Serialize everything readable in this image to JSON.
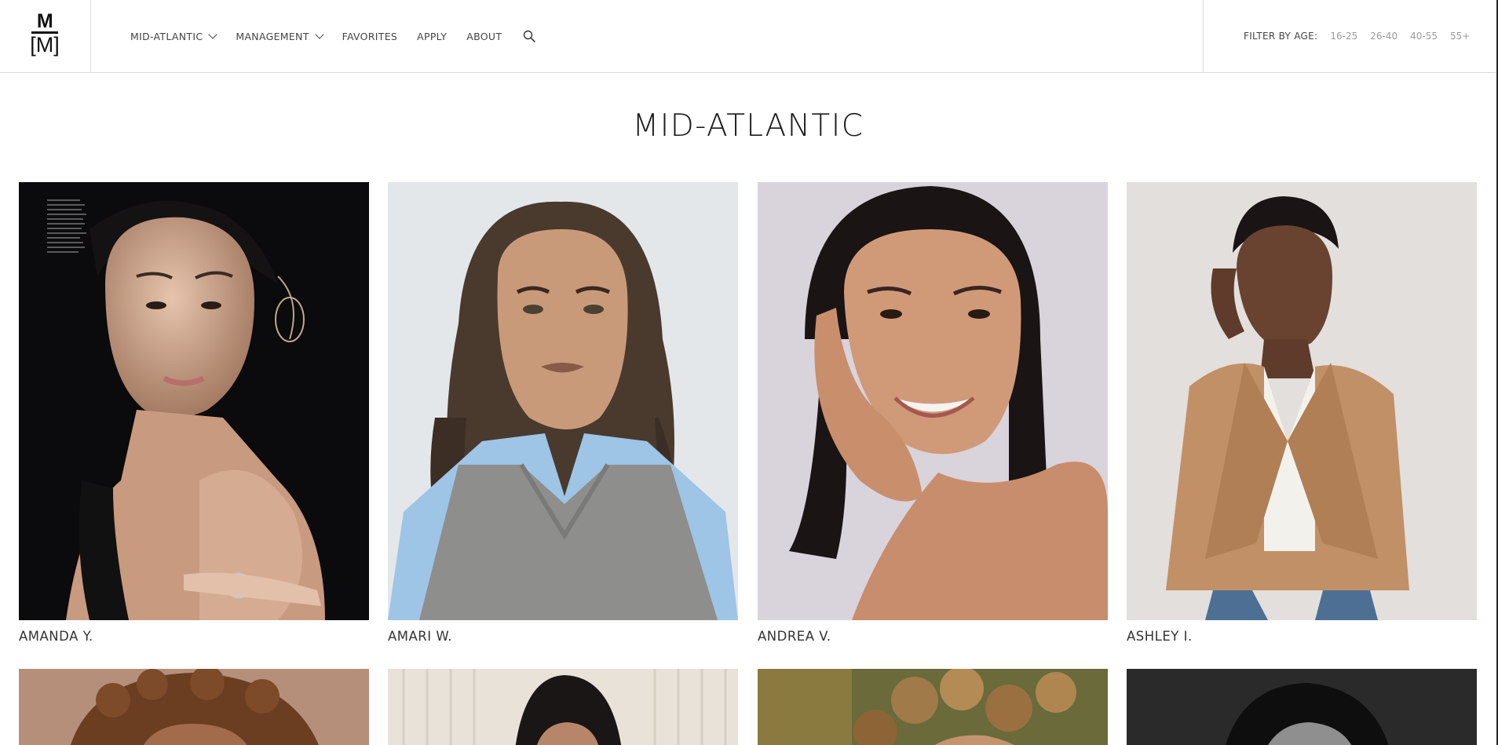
{
  "header": {
    "logo": {
      "top": "M",
      "bottom": "[M]"
    },
    "nav": [
      {
        "label": "MID-ATLANTIC",
        "has_dropdown": true
      },
      {
        "label": "MANAGEMENT",
        "has_dropdown": true
      },
      {
        "label": "FAVORITES",
        "has_dropdown": false
      },
      {
        "label": "APPLY",
        "has_dropdown": false
      },
      {
        "label": "ABOUT",
        "has_dropdown": false
      }
    ],
    "search_icon": "search-icon",
    "filter": {
      "label": "FILTER BY AGE:",
      "options": [
        "16-25",
        "26-40",
        "40-55",
        "55+"
      ]
    }
  },
  "page": {
    "title": "MID-ATLANTIC"
  },
  "models": [
    {
      "name": "AMANDA Y."
    },
    {
      "name": "AMARI W."
    },
    {
      "name": "ANDREA V."
    },
    {
      "name": "ASHLEY I."
    }
  ],
  "colors": {
    "text": "#222222",
    "muted": "#9a9a9a",
    "divider": "#dcdcdc"
  }
}
